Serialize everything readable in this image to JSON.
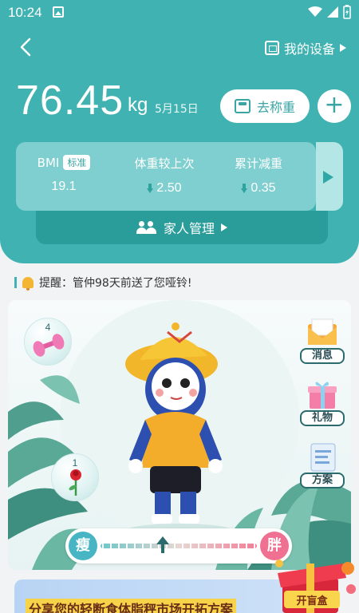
{
  "status_bar": {
    "time": "10:24"
  },
  "header": {
    "my_device_label": "我的设备",
    "weight_value": "76.45",
    "weight_unit": "kg",
    "date": "5月15日",
    "weigh_button_label": "去称重",
    "add_button_label": "+"
  },
  "stats": {
    "bmi": {
      "label": "BMI",
      "tag": "标准",
      "value": "19.1"
    },
    "change": {
      "label": "体重较上次",
      "value": "2.50"
    },
    "total": {
      "label": "累计减重",
      "value": "0.35"
    }
  },
  "family_label": "家人管理",
  "reminder": "提醒：管仲98天前送了您哑铃!",
  "scene": {
    "dumbbell_count": "4",
    "rose_count": "1",
    "message_label": "消息",
    "gift_label": "礼物",
    "plan_label": "方案",
    "slider_left_label": "瘦",
    "slider_right_label": "胖",
    "slider_position": 0.4
  },
  "banner": {
    "text": "分享您的轻断食体脂秤市场开拓方案",
    "blind_box_label": "开盲盒"
  },
  "colors": {
    "primary": "#3fb2b1",
    "accent_dark": "#2a9c9a"
  }
}
